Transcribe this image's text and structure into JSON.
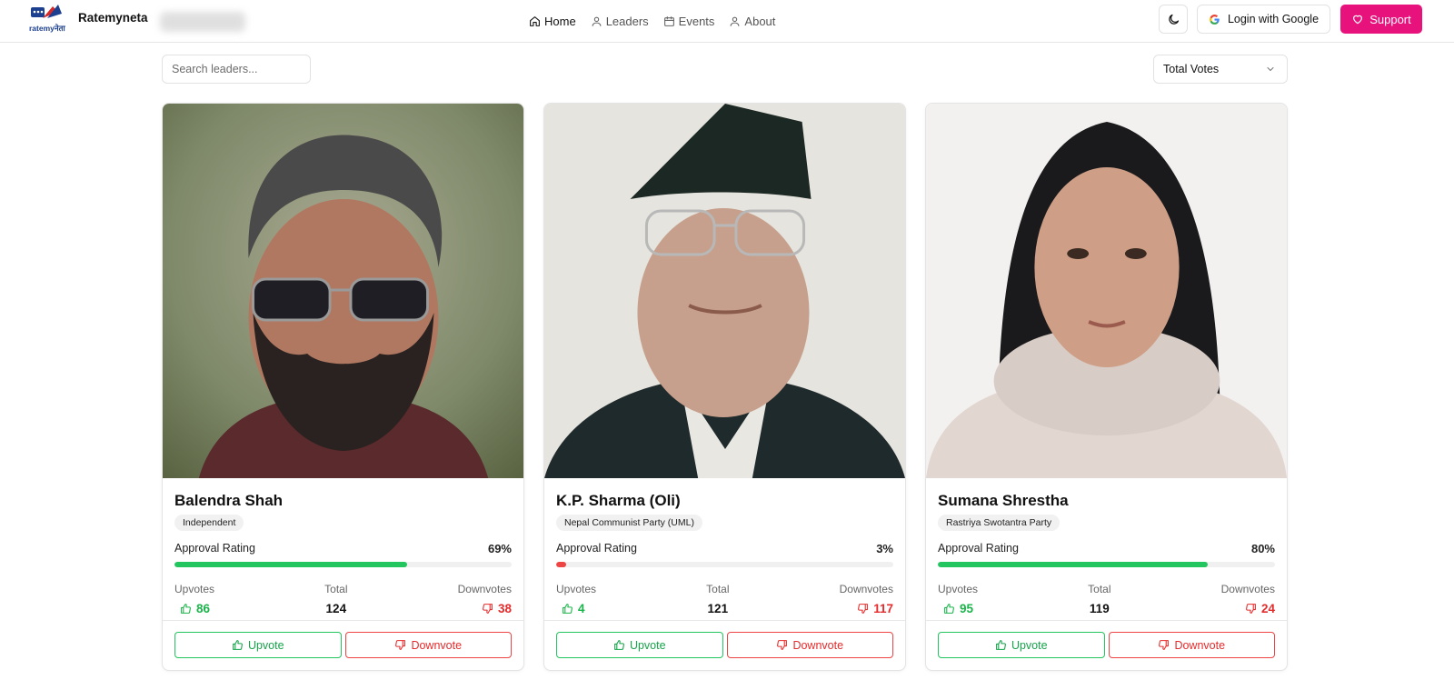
{
  "header": {
    "logo_text": "ratemyनेता",
    "brand": "Ratemyneta",
    "nav": [
      {
        "label": "Home",
        "icon": "home-icon",
        "active": true
      },
      {
        "label": "Leaders",
        "icon": "user-icon",
        "active": false
      },
      {
        "label": "Events",
        "icon": "calendar-icon",
        "active": false
      },
      {
        "label": "About",
        "icon": "user-icon",
        "active": false
      }
    ],
    "login_label": "Login with Google",
    "support_label": "Support"
  },
  "toolbar": {
    "search_placeholder": "Search leaders...",
    "sort_value": "Total Votes"
  },
  "labels": {
    "approval": "Approval Rating",
    "upvotes": "Upvotes",
    "total": "Total",
    "downvotes": "Downvotes",
    "upvote_button": "Upvote",
    "downvote_button": "Downvote"
  },
  "colors": {
    "accent_pink": "#e8127c",
    "positive": "#22c55e",
    "negative": "#ef4444"
  },
  "leaders": [
    {
      "name": "Balendra Shah",
      "party": "Independent",
      "approval_text": "69%",
      "approval": 0.69,
      "upvotes": "86",
      "total": "124",
      "downvotes": "38"
    },
    {
      "name": "K.P. Sharma (Oli)",
      "party": "Nepal Communist Party (UML)",
      "approval_text": "3%",
      "approval": 0.03,
      "upvotes": "4",
      "total": "121",
      "downvotes": "117"
    },
    {
      "name": "Sumana Shrestha",
      "party": "Rastriya Swotantra Party",
      "approval_text": "80%",
      "approval": 0.8,
      "upvotes": "95",
      "total": "119",
      "downvotes": "24"
    }
  ]
}
